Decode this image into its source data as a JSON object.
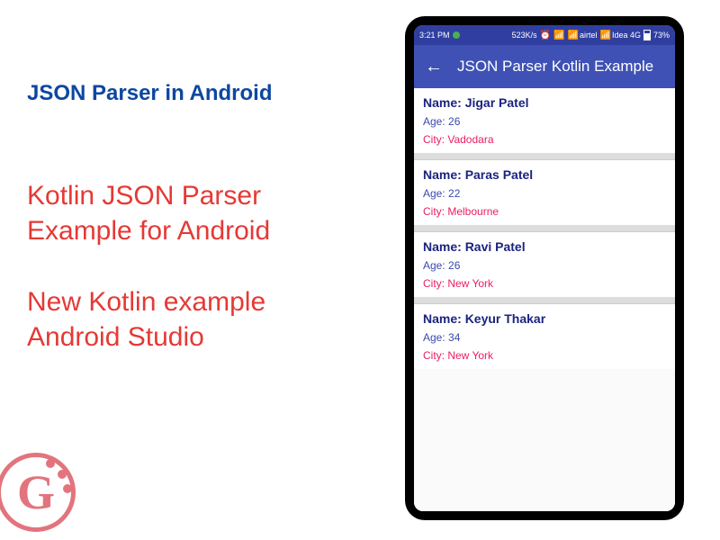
{
  "page": {
    "title_blue": "JSON Parser in Android",
    "title_red_1": "Kotlin JSON Parser\n Example for Android",
    "title_red_2": "New Kotlin example\n Android Studio"
  },
  "phone": {
    "status": {
      "time": "3:21 PM",
      "speed": "523K/s",
      "carrier1": "airtel",
      "carrier2": "Idea 4G",
      "battery": "73%"
    },
    "app_bar": {
      "title": "JSON Parser Kotlin Example"
    },
    "list": [
      {
        "name_label": "Name:",
        "name": "Jigar Patel",
        "age_label": "Age:",
        "age": "26",
        "city_label": "City:",
        "city": "Vadodara"
      },
      {
        "name_label": "Name:",
        "name": "Paras Patel",
        "age_label": "Age:",
        "age": "22",
        "city_label": "City:",
        "city": "Melbourne"
      },
      {
        "name_label": "Name:",
        "name": "Ravi Patel",
        "age_label": "Age:",
        "age": "26",
        "city_label": "City:",
        "city": "New York"
      },
      {
        "name_label": "Name:",
        "name": "Keyur Thakar",
        "age_label": "Age:",
        "age": "34",
        "city_label": "City:",
        "city": "New York"
      }
    ]
  }
}
